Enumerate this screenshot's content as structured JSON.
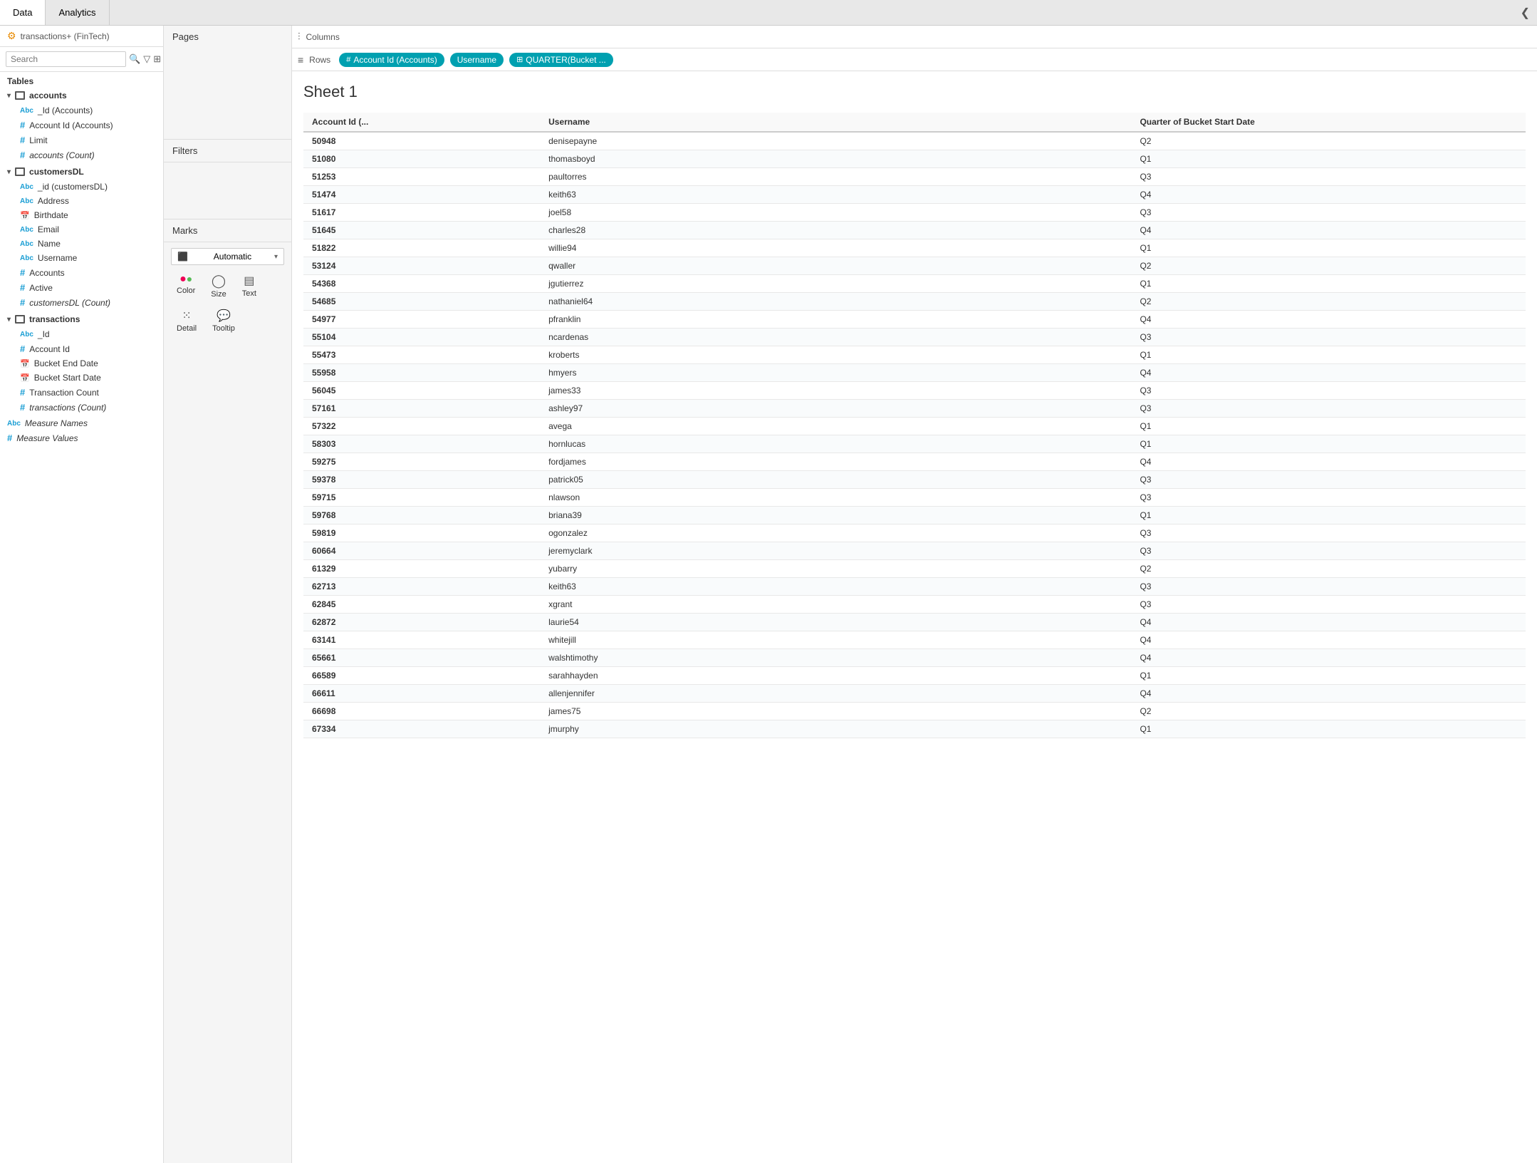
{
  "tabs": {
    "data_label": "Data",
    "analytics_label": "Analytics",
    "collapse_icon": "❮"
  },
  "left_panel": {
    "connection_label": "transactions+ (FinTech)",
    "search_placeholder": "Search",
    "tables_label": "Tables",
    "groups": [
      {
        "name": "accounts",
        "fields": [
          {
            "type": "abc",
            "label": "_Id (Accounts)"
          },
          {
            "type": "hash",
            "label": "Account Id (Accounts)"
          },
          {
            "type": "hash",
            "label": "Limit"
          },
          {
            "type": "hash_italic",
            "label": "accounts (Count)"
          }
        ]
      },
      {
        "name": "customersDL",
        "fields": [
          {
            "type": "abc",
            "label": "_id (customersDL)"
          },
          {
            "type": "abc",
            "label": "Address"
          },
          {
            "type": "cal",
            "label": "Birthdate"
          },
          {
            "type": "abc",
            "label": "Email"
          },
          {
            "type": "abc",
            "label": "Name"
          },
          {
            "type": "abc",
            "label": "Username"
          },
          {
            "type": "hash",
            "label": "Accounts"
          },
          {
            "type": "hash",
            "label": "Active"
          },
          {
            "type": "hash_italic",
            "label": "customersDL (Count)"
          }
        ]
      },
      {
        "name": "transactions",
        "fields": [
          {
            "type": "abc",
            "label": "_Id"
          },
          {
            "type": "hash",
            "label": "Account Id"
          },
          {
            "type": "cal",
            "label": "Bucket End Date"
          },
          {
            "type": "cal",
            "label": "Bucket Start Date"
          },
          {
            "type": "hash",
            "label": "Transaction Count"
          },
          {
            "type": "hash_italic",
            "label": "transactions (Count)"
          }
        ]
      }
    ],
    "measure_names": "Measure Names",
    "measure_values": "Measure Values"
  },
  "middle_panel": {
    "pages_label": "Pages",
    "filters_label": "Filters",
    "marks_label": "Marks",
    "marks_type": "Automatic",
    "mark_buttons": [
      {
        "name": "Color",
        "icon": "⬤⬤"
      },
      {
        "name": "Size",
        "icon": "◯"
      },
      {
        "name": "Text",
        "icon": "▤"
      },
      {
        "name": "Detail",
        "icon": "⁙"
      },
      {
        "name": "Tooltip",
        "icon": "💬"
      }
    ]
  },
  "toolbar": {
    "columns_icon": "⫶",
    "columns_label": "Columns",
    "rows_icon": "≡",
    "rows_label": "Rows",
    "pills": [
      {
        "label": "Account Id (Accounts)",
        "icon": "🔢"
      },
      {
        "label": "Username",
        "icon": ""
      },
      {
        "label": "QUARTER(Bucket ...",
        "icon": "⊞"
      }
    ]
  },
  "sheet": {
    "title": "Sheet 1",
    "columns": [
      {
        "label": "Account Id (..."
      },
      {
        "label": "Username"
      },
      {
        "label": "Quarter of Bucket Start Date"
      }
    ],
    "rows": [
      {
        "account_id": "50948",
        "username": "denisepayne",
        "quarter": "Q2"
      },
      {
        "account_id": "51080",
        "username": "thomasboyd",
        "quarter": "Q1"
      },
      {
        "account_id": "51253",
        "username": "paultorres",
        "quarter": "Q3"
      },
      {
        "account_id": "51474",
        "username": "keith63",
        "quarter": "Q4"
      },
      {
        "account_id": "51617",
        "username": "joel58",
        "quarter": "Q3"
      },
      {
        "account_id": "51645",
        "username": "charles28",
        "quarter": "Q4"
      },
      {
        "account_id": "51822",
        "username": "willie94",
        "quarter": "Q1"
      },
      {
        "account_id": "53124",
        "username": "qwaller",
        "quarter": "Q2"
      },
      {
        "account_id": "54368",
        "username": "jgutierrez",
        "quarter": "Q1"
      },
      {
        "account_id": "54685",
        "username": "nathaniel64",
        "quarter": "Q2"
      },
      {
        "account_id": "54977",
        "username": "pfranklin",
        "quarter": "Q4"
      },
      {
        "account_id": "55104",
        "username": "ncardenas",
        "quarter": "Q3"
      },
      {
        "account_id": "55473",
        "username": "kroberts",
        "quarter": "Q1"
      },
      {
        "account_id": "55958",
        "username": "hmyers",
        "quarter": "Q4"
      },
      {
        "account_id": "56045",
        "username": "james33",
        "quarter": "Q3"
      },
      {
        "account_id": "57161",
        "username": "ashley97",
        "quarter": "Q3"
      },
      {
        "account_id": "57322",
        "username": "avega",
        "quarter": "Q1"
      },
      {
        "account_id": "58303",
        "username": "hornlucas",
        "quarter": "Q1"
      },
      {
        "account_id": "59275",
        "username": "fordjames",
        "quarter": "Q4"
      },
      {
        "account_id": "59378",
        "username": "patrick05",
        "quarter": "Q3"
      },
      {
        "account_id": "59715",
        "username": "nlawson",
        "quarter": "Q3"
      },
      {
        "account_id": "59768",
        "username": "briana39",
        "quarter": "Q1"
      },
      {
        "account_id": "59819",
        "username": "ogonzalez",
        "quarter": "Q3"
      },
      {
        "account_id": "60664",
        "username": "jeremyclark",
        "quarter": "Q3"
      },
      {
        "account_id": "61329",
        "username": "yubarry",
        "quarter": "Q2"
      },
      {
        "account_id": "62713",
        "username": "keith63",
        "quarter": "Q3"
      },
      {
        "account_id": "62845",
        "username": "xgrant",
        "quarter": "Q3"
      },
      {
        "account_id": "62872",
        "username": "laurie54",
        "quarter": "Q4"
      },
      {
        "account_id": "63141",
        "username": "whitejill",
        "quarter": "Q4"
      },
      {
        "account_id": "65661",
        "username": "walshtimothy",
        "quarter": "Q4"
      },
      {
        "account_id": "66589",
        "username": "sarahhayden",
        "quarter": "Q1"
      },
      {
        "account_id": "66611",
        "username": "allenjennifer",
        "quarter": "Q4"
      },
      {
        "account_id": "66698",
        "username": "james75",
        "quarter": "Q2"
      },
      {
        "account_id": "67334",
        "username": "jmurphy",
        "quarter": "Q1"
      }
    ]
  }
}
